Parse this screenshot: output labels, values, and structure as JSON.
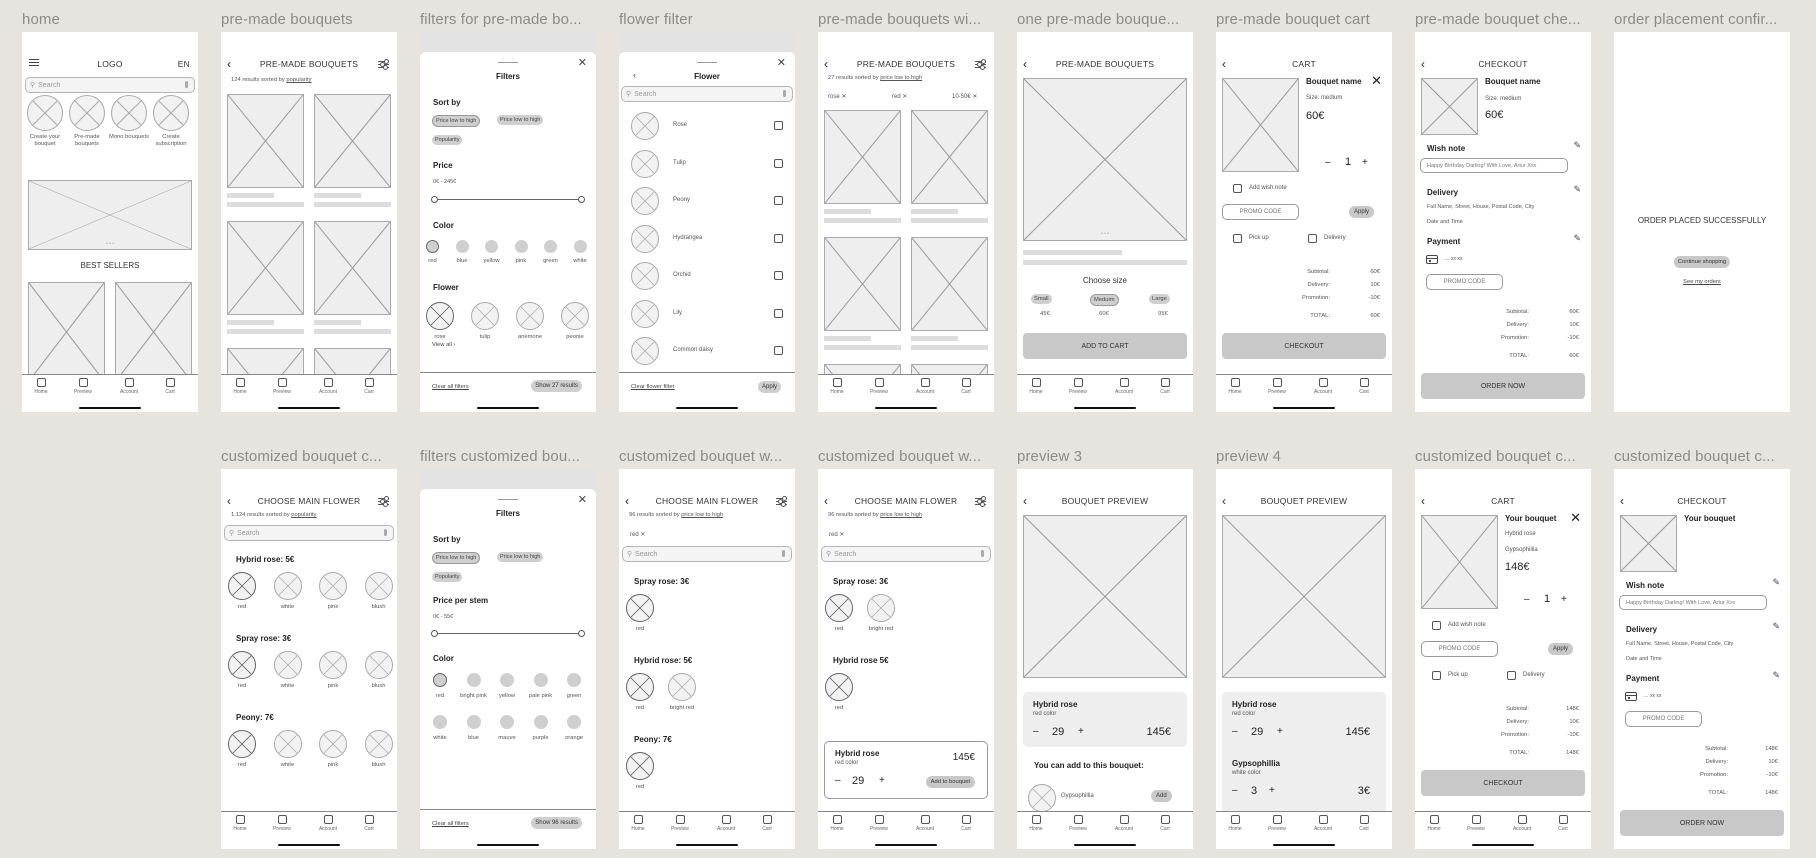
{
  "frames": {
    "f1": {
      "label": "home"
    },
    "f2": {
      "label": "pre-made bouquets"
    },
    "f3": {
      "label": "filters for pre-made bo..."
    },
    "f4": {
      "label": "flower filter"
    },
    "f5": {
      "label": "pre-made bouquets wi..."
    },
    "f6": {
      "label": "one pre-made bouque..."
    },
    "f7": {
      "label": "pre-made bouquet cart"
    },
    "f8": {
      "label": "pre-made bouquet che..."
    },
    "f9": {
      "label": "order placement confir..."
    },
    "g2": {
      "label": "customized bouquet c..."
    },
    "g3": {
      "label": "filters customized bou..."
    },
    "g4": {
      "label": "customized bouquet w..."
    },
    "g5": {
      "label": "customized bouquet w..."
    },
    "g6": {
      "label": "preview 3"
    },
    "g7": {
      "label": "preview 4"
    },
    "g8": {
      "label": "customized bouquet c..."
    },
    "g9": {
      "label": "customized bouquet c..."
    }
  },
  "nav": {
    "home": "Home",
    "preview": "Preview",
    "account": "Account",
    "cart": "Cart"
  },
  "icons": {
    "back": "‹",
    "close": "✕",
    "x": "✕",
    "pencil": "✎",
    "chevron": "›"
  },
  "common": {
    "search_placeholder": "Search",
    "promo_placeholder": "PROMO CODE",
    "apply": "Apply",
    "subtotal": "Subtotal:",
    "delivery": "Delivery:",
    "promotion": "Promotion:",
    "total": "TOTAL:",
    "minus": "–",
    "plus": "+"
  },
  "home": {
    "logo": "LOGO",
    "lang": "EN",
    "categories": [
      "Create your bouquet",
      "Pre-made bouquets",
      "Mono bouquets",
      "Create subscription"
    ],
    "carousel_dots": "• • •",
    "best_sellers": "BEST SELLERS"
  },
  "premade": {
    "title": "PRE-MADE BOUQUETS",
    "results_prefix": "124 results sorted by ",
    "results_sort": "popularity"
  },
  "filters1": {
    "title": "Filters",
    "sort_by": "Sort by",
    "sort_options": [
      "Price low to high",
      "Price low to high",
      "Popularity"
    ],
    "price": "Price",
    "price_range": "0€ - 245€",
    "price_min": 0,
    "price_max": 245,
    "color": "Color",
    "colors": [
      "red",
      "blue",
      "yellow",
      "pink",
      "green",
      "white"
    ],
    "selected_color": "red",
    "flower": "Flower",
    "flowers": [
      "rose",
      "tulip",
      "anemone",
      "peonie"
    ],
    "selected_flower": "rose",
    "view_all": "View all",
    "clear": "Clear all filters",
    "show": "Show 27 results"
  },
  "flowerfilter": {
    "title": "Flower",
    "items": [
      "Rose",
      "Tulip",
      "Peony",
      "Hydrangea",
      "Orchid",
      "Lily",
      "Common daisy"
    ],
    "clear": "Clear flower filter",
    "apply": "Apply"
  },
  "premade_filtered": {
    "title": "PRE-MADE BOUQUETS",
    "results_prefix": "27 results sorted by ",
    "results_sort": "price low to high",
    "chips": [
      "rose",
      "red",
      "10-50€"
    ]
  },
  "one_bouquet": {
    "title": "PRE-MADE BOUQUETS",
    "choose_size": "Choose size",
    "sizes": [
      {
        "label": "Small",
        "price": "45€"
      },
      {
        "label": "Meduim",
        "price": "60€"
      },
      {
        "label": "Large",
        "price": "95€"
      }
    ],
    "selected_size": "Meduim",
    "add_to_cart": "ADD TO CART"
  },
  "cart1": {
    "title": "CART",
    "name": "Bouquet name",
    "size": "Size: medium",
    "price": "60€",
    "qty": "1",
    "add_wish": "Add wish note",
    "pickup": "Pick up",
    "delivery_opt": "Delivery",
    "totals": [
      "60€",
      "10€",
      "-10€",
      "60€"
    ],
    "checkout": "CHECKOUT"
  },
  "checkout1": {
    "title": "CHECKOUT",
    "name": "Bouquet name",
    "size": "Size: medium",
    "price": "60€",
    "wish_note": "Wish note",
    "wish_text": "Happy Birthday Darling! With Love, Artur Xxx",
    "delivery": "Delivery",
    "address": "Full Name, Street, House, Postal Code, City",
    "datetime": "Date and Time",
    "payment": "Payment",
    "card": ".... xx xx",
    "totals": [
      "60€",
      "10€",
      "-10€",
      "60€"
    ],
    "order_now": "ORDER NOW"
  },
  "confirm": {
    "message": "ORDER PLACED SUCCESSFULLY",
    "continue": "Continue shopping",
    "see_orders": "See my orders"
  },
  "choose_flower": {
    "title": "CHOOSE MAIN FLOWER",
    "results_prefix": "1.124 results sorted by ",
    "results_sort": "popularity",
    "groups": [
      {
        "name": "Hybrid rose: 5€",
        "colors": [
          "red",
          "white",
          "pink",
          "blush"
        ]
      },
      {
        "name": "Spray rose: 3€",
        "colors": [
          "red",
          "white",
          "pink",
          "blush"
        ]
      },
      {
        "name": "Peony: 7€",
        "colors": [
          "red",
          "white",
          "pink",
          "blush"
        ]
      }
    ]
  },
  "filters2": {
    "title": "Filters",
    "sort_by": "Sort by",
    "sort_options": [
      "Price low to high",
      "Price low to high",
      "Popularity"
    ],
    "price": "Price per stem",
    "price_range": "0€ - 55€",
    "price_min": 0,
    "price_max": 55,
    "color": "Color",
    "colors": [
      "red",
      "bright pink",
      "yellow",
      "pale pink",
      "green",
      "white",
      "blue",
      "mauve",
      "purple",
      "orange"
    ],
    "selected_color": "red",
    "clear": "Clear all filters",
    "show": "Show 96 results"
  },
  "choose_filtered": {
    "title": "CHOOSE MAIN FLOWER",
    "results_prefix": "96 results sorted by ",
    "results_sort": "price low to high",
    "chip": "red",
    "groups": [
      {
        "name": "Spray rose: 3€",
        "colors": [
          "red"
        ]
      },
      {
        "name": "Hybrid rose: 5€",
        "colors": [
          "red",
          "bright red"
        ]
      },
      {
        "name": "Peony: 7€",
        "colors": [
          "red"
        ]
      }
    ]
  },
  "choose_selected": {
    "title": "CHOOSE MAIN FLOWER",
    "results_prefix": "96 results sorted by ",
    "results_sort": "price low to high",
    "chip": "red",
    "groups": [
      {
        "name": "Spray rose: 3€",
        "colors": [
          "red",
          "bright red"
        ]
      },
      {
        "name": "Hybrid rose 5€",
        "colors": [
          "red"
        ]
      }
    ],
    "panel": {
      "name": "Hybrid rose",
      "color": "red color",
      "qty": "29",
      "price": "145€",
      "add": "Add to bouquet"
    }
  },
  "preview3": {
    "title": "BOUQUET PREVIEW",
    "item": {
      "name": "Hybrid rose",
      "color": "red color",
      "qty": "29",
      "price": "145€"
    },
    "add_heading": "You can add to this bouquet:",
    "suggestion": "Gypsophillia",
    "add": "Add"
  },
  "preview4": {
    "title": "BOUQUET PREVIEW",
    "items": [
      {
        "name": "Hybrid rose",
        "color": "red color",
        "qty": "29",
        "price": "145€"
      },
      {
        "name": "Gypsophillia",
        "color": "white color",
        "qty": "3",
        "price": "3€"
      }
    ]
  },
  "cart2": {
    "title": "CART",
    "name": "Your bouquet",
    "line1": "Hybrid rose",
    "line2": "Gypsophillia",
    "price": "148€",
    "qty": "1",
    "add_wish": "Add wish note",
    "pickup": "Pick up",
    "delivery_opt": "Delivery",
    "totals": [
      "148€",
      "10€",
      "-10€",
      "148€"
    ],
    "checkout": "CHECKOUT"
  },
  "checkout2": {
    "title": "CHECKOUT",
    "name": "Your bouquet",
    "wish_note": "Wish note",
    "wish_text": "Happy Birthday Darling! With Love, Artur Xxx",
    "delivery": "Delivery",
    "address": "Full Name, Street, House, Postal Code, City",
    "datetime": "Date and Time",
    "payment": "Payment",
    "card": ".... xx xx",
    "totals": [
      "148€",
      "10€",
      "-10€",
      "148€"
    ],
    "order_now": "ORDER NOW"
  }
}
